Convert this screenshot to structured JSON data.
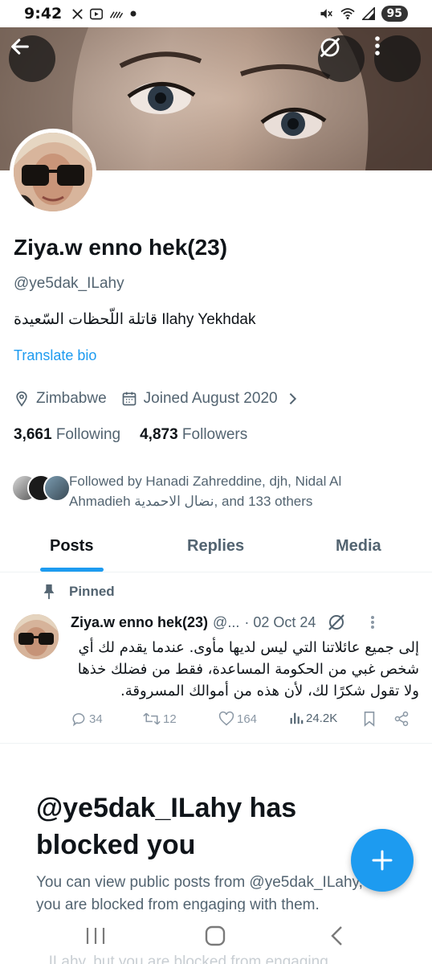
{
  "status_bar": {
    "time": "9:42",
    "battery": "95",
    "left_icons": [
      "x-logo-icon",
      "video-icon",
      "no-signal-icon",
      "dot-icon"
    ],
    "right_icons": [
      "mute-icon",
      "wifi-icon",
      "signal-icon"
    ]
  },
  "profile": {
    "name": "Ziya.w enno hek(23)",
    "handle": "@ye5dak_ILahy",
    "bio": "قاتلة اللّحظات السّعيدة Ilahy Yekhdak",
    "translate_label": "Translate bio",
    "location": "Zimbabwe",
    "joined": "Joined August 2020",
    "following_count": "3,661",
    "following_label": "Following",
    "followers_count": "4,873",
    "followers_label": "Followers",
    "followed_by": "Followed by Hanadi Zahreddine, djh, Nidal Al Ahmadieh نضال الاحمدية, and 133 others"
  },
  "tabs": [
    {
      "label": "Posts",
      "active": true
    },
    {
      "label": "Replies",
      "active": false
    },
    {
      "label": "Media",
      "active": false
    }
  ],
  "pinned_label": "Pinned",
  "post": {
    "name": "Ziya.w enno hek(23)",
    "handle": "@...",
    "date": "· 02 Oct 24",
    "text": "إلى جميع عائلاتنا التي ليس لديها مأوى. عندما يقدم لك أي شخص غبي من الحكومة المساعدة، فقط من فضلك خذها ولا تقول شكرًا لك، لأن هذه من أموالك المسروقة.",
    "replies": "34",
    "reposts": "12",
    "likes": "164",
    "views": "24.2K"
  },
  "blocked": {
    "title": "@ye5dak_ILahy has blocked you",
    "text": "You can view public posts from @ye5dak_ILahy, but you are blocked from engaging with them.",
    "ghost_text": "_ILahy, but you are blocked from engaging"
  },
  "colors": {
    "accent": "#1d9bf0",
    "text_primary": "#0f1419",
    "text_secondary": "#536471"
  }
}
